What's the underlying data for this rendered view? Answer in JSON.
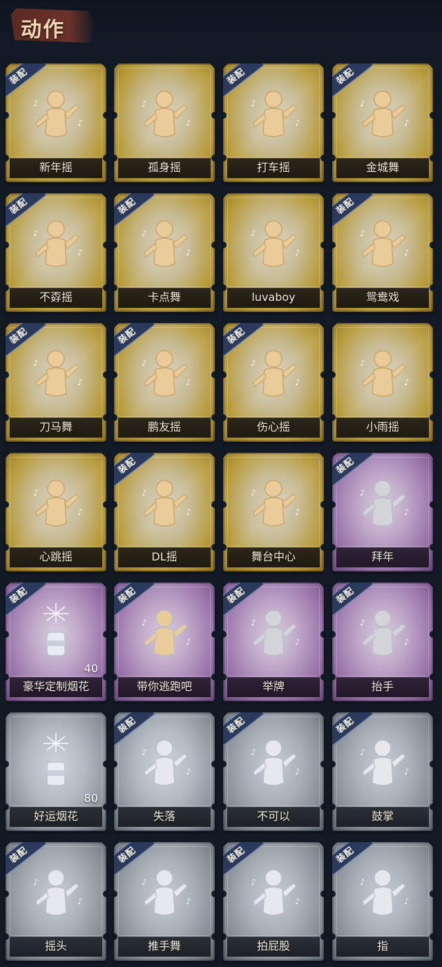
{
  "header": {
    "title": "动作"
  },
  "equip_badge": "装配",
  "cards": [
    {
      "label": "新年摇",
      "tier": "gold",
      "equip": true
    },
    {
      "label": "孤身摇",
      "tier": "gold",
      "equip": false
    },
    {
      "label": "打车摇",
      "tier": "gold",
      "equip": true
    },
    {
      "label": "金城舞",
      "tier": "gold",
      "equip": true
    },
    {
      "label": "不孬摇",
      "tier": "gold",
      "equip": true
    },
    {
      "label": "卡点舞",
      "tier": "gold",
      "equip": true
    },
    {
      "label": "luvaboy",
      "tier": "gold",
      "equip": false
    },
    {
      "label": "鸳鸯戏",
      "tier": "gold",
      "equip": true
    },
    {
      "label": "刀马舞",
      "tier": "gold",
      "equip": true
    },
    {
      "label": "鹏友摇",
      "tier": "gold",
      "equip": true
    },
    {
      "label": "伤心摇",
      "tier": "gold",
      "equip": true
    },
    {
      "label": "小雨摇",
      "tier": "gold",
      "equip": false
    },
    {
      "label": "心跳摇",
      "tier": "gold",
      "equip": false
    },
    {
      "label": "DL摇",
      "tier": "gold",
      "equip": true
    },
    {
      "label": "舞台中心",
      "tier": "gold",
      "equip": false
    },
    {
      "label": "拜年",
      "tier": "purple",
      "equip": true
    },
    {
      "label": "豪华定制烟花",
      "tier": "purple",
      "equip": true,
      "count": "40"
    },
    {
      "label": "带你逃跑吧",
      "tier": "purple",
      "equip": true
    },
    {
      "label": "举牌",
      "tier": "purple",
      "equip": true
    },
    {
      "label": "抬手",
      "tier": "purple",
      "equip": true
    },
    {
      "label": "好运烟花",
      "tier": "grey",
      "equip": false,
      "count": "80"
    },
    {
      "label": "失落",
      "tier": "grey",
      "equip": true
    },
    {
      "label": "不可以",
      "tier": "grey2",
      "equip": true
    },
    {
      "label": "鼓掌",
      "tier": "grey2",
      "equip": true
    },
    {
      "label": "摇头",
      "tier": "grey2",
      "equip": true
    },
    {
      "label": "推手舞",
      "tier": "grey2",
      "equip": true
    },
    {
      "label": "拍屁股",
      "tier": "grey2",
      "equip": true
    },
    {
      "label": "指",
      "tier": "grey2",
      "equip": true
    }
  ],
  "icons": {
    "figure": "dancer-silhouette-icon",
    "firework": "firework-icon"
  },
  "colors": {
    "gold": "#b89b3b",
    "purple": "#9a74aa",
    "grey": "#8a929c",
    "ribbon": "#2b3a5c"
  }
}
